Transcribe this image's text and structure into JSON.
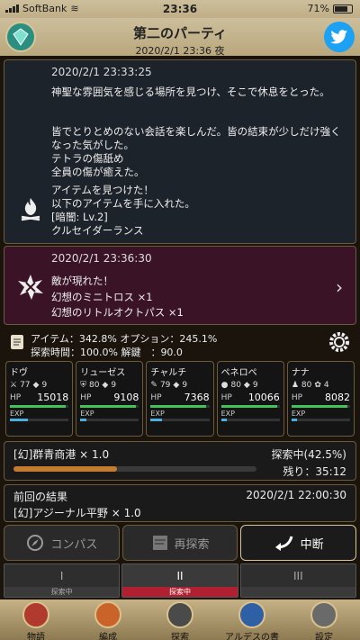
{
  "status": {
    "carrier": "SoftBank",
    "time": "23:36",
    "battery": "71%"
  },
  "header": {
    "title": "第二のパーティ",
    "subtitle": "2020/2/1 23:36 夜"
  },
  "log1": {
    "timestamp": "2020/2/1 23:33:25",
    "line1": "神聖な雰囲気を感じる場所を見つけ、そこで休息をとった。",
    "line2": "皆でとりとめのない会話を楽しんだ。皆の結束が少しだけ強くなった気がした。\nテトラの傷舐め\n全員の傷が癒えた。",
    "line3": "アイテムを見つけた！\n以下のアイテムを手に入れた。",
    "level_tag": "[暗闇: Lv.2]",
    "item": "クルセイダーランス"
  },
  "log2": {
    "timestamp": "2020/2/1 23:36:30",
    "text": "敵が現れた！",
    "enemy1": "幻想のミニトロス ×1",
    "enemy2": "幻想のリトルオクトパス ×1"
  },
  "stats": {
    "line1": "アイテム：342.8% オプション：245.1%",
    "line2": "探索時間：100.0% 解鍵　：90.0"
  },
  "members": [
    {
      "name": "ドヴ",
      "lv": "77",
      "sk": "9",
      "hp": "15018",
      "hp_fill": 0.95,
      "exp_fill": 0.3
    },
    {
      "name": "リューゼス",
      "lv": "80",
      "sk": "9",
      "hp": "9108",
      "hp_fill": 0.95,
      "exp_fill": 0.1
    },
    {
      "name": "チャルチ",
      "lv": "79",
      "sk": "9",
      "hp": "7368",
      "hp_fill": 0.95,
      "exp_fill": 0.2
    },
    {
      "name": "ペネロペ",
      "lv": "80",
      "sk": "9",
      "hp": "10066",
      "hp_fill": 0.95,
      "exp_fill": 0.1
    },
    {
      "name": "ナナ",
      "lv": "80",
      "sk": "4",
      "hp": "8082",
      "hp_fill": 0.95,
      "exp_fill": 0.1
    }
  ],
  "member_labels": {
    "hp": "HP",
    "exp": "EXP"
  },
  "explore": {
    "place": "[幻]群青商港 × 1.0",
    "status": "探索中(42.5%)",
    "remaining": "残り：35:12",
    "progress": 0.425
  },
  "previous": {
    "label": "前回の結果",
    "datetime": "2020/2/1 22:00:30",
    "place": "[幻]アジーナル平野 × 1.0"
  },
  "actions": {
    "compass": "コンパス",
    "reexplore": "再探索",
    "interrupt": "中断"
  },
  "tabs": [
    {
      "num": "I",
      "status": "探索中"
    },
    {
      "num": "II",
      "status": "探索中"
    },
    {
      "num": "III",
      "status": ""
    }
  ],
  "nav": {
    "story": "物語",
    "formation": "編成",
    "explore": "探索",
    "book": "アルデスの書",
    "settings": "設定"
  },
  "colors": {
    "accent": "#d8c59a",
    "hp": "#43c15a",
    "exp": "#4ab0e0",
    "progress": "#c47a2f",
    "tab_selected": "#b02030"
  }
}
